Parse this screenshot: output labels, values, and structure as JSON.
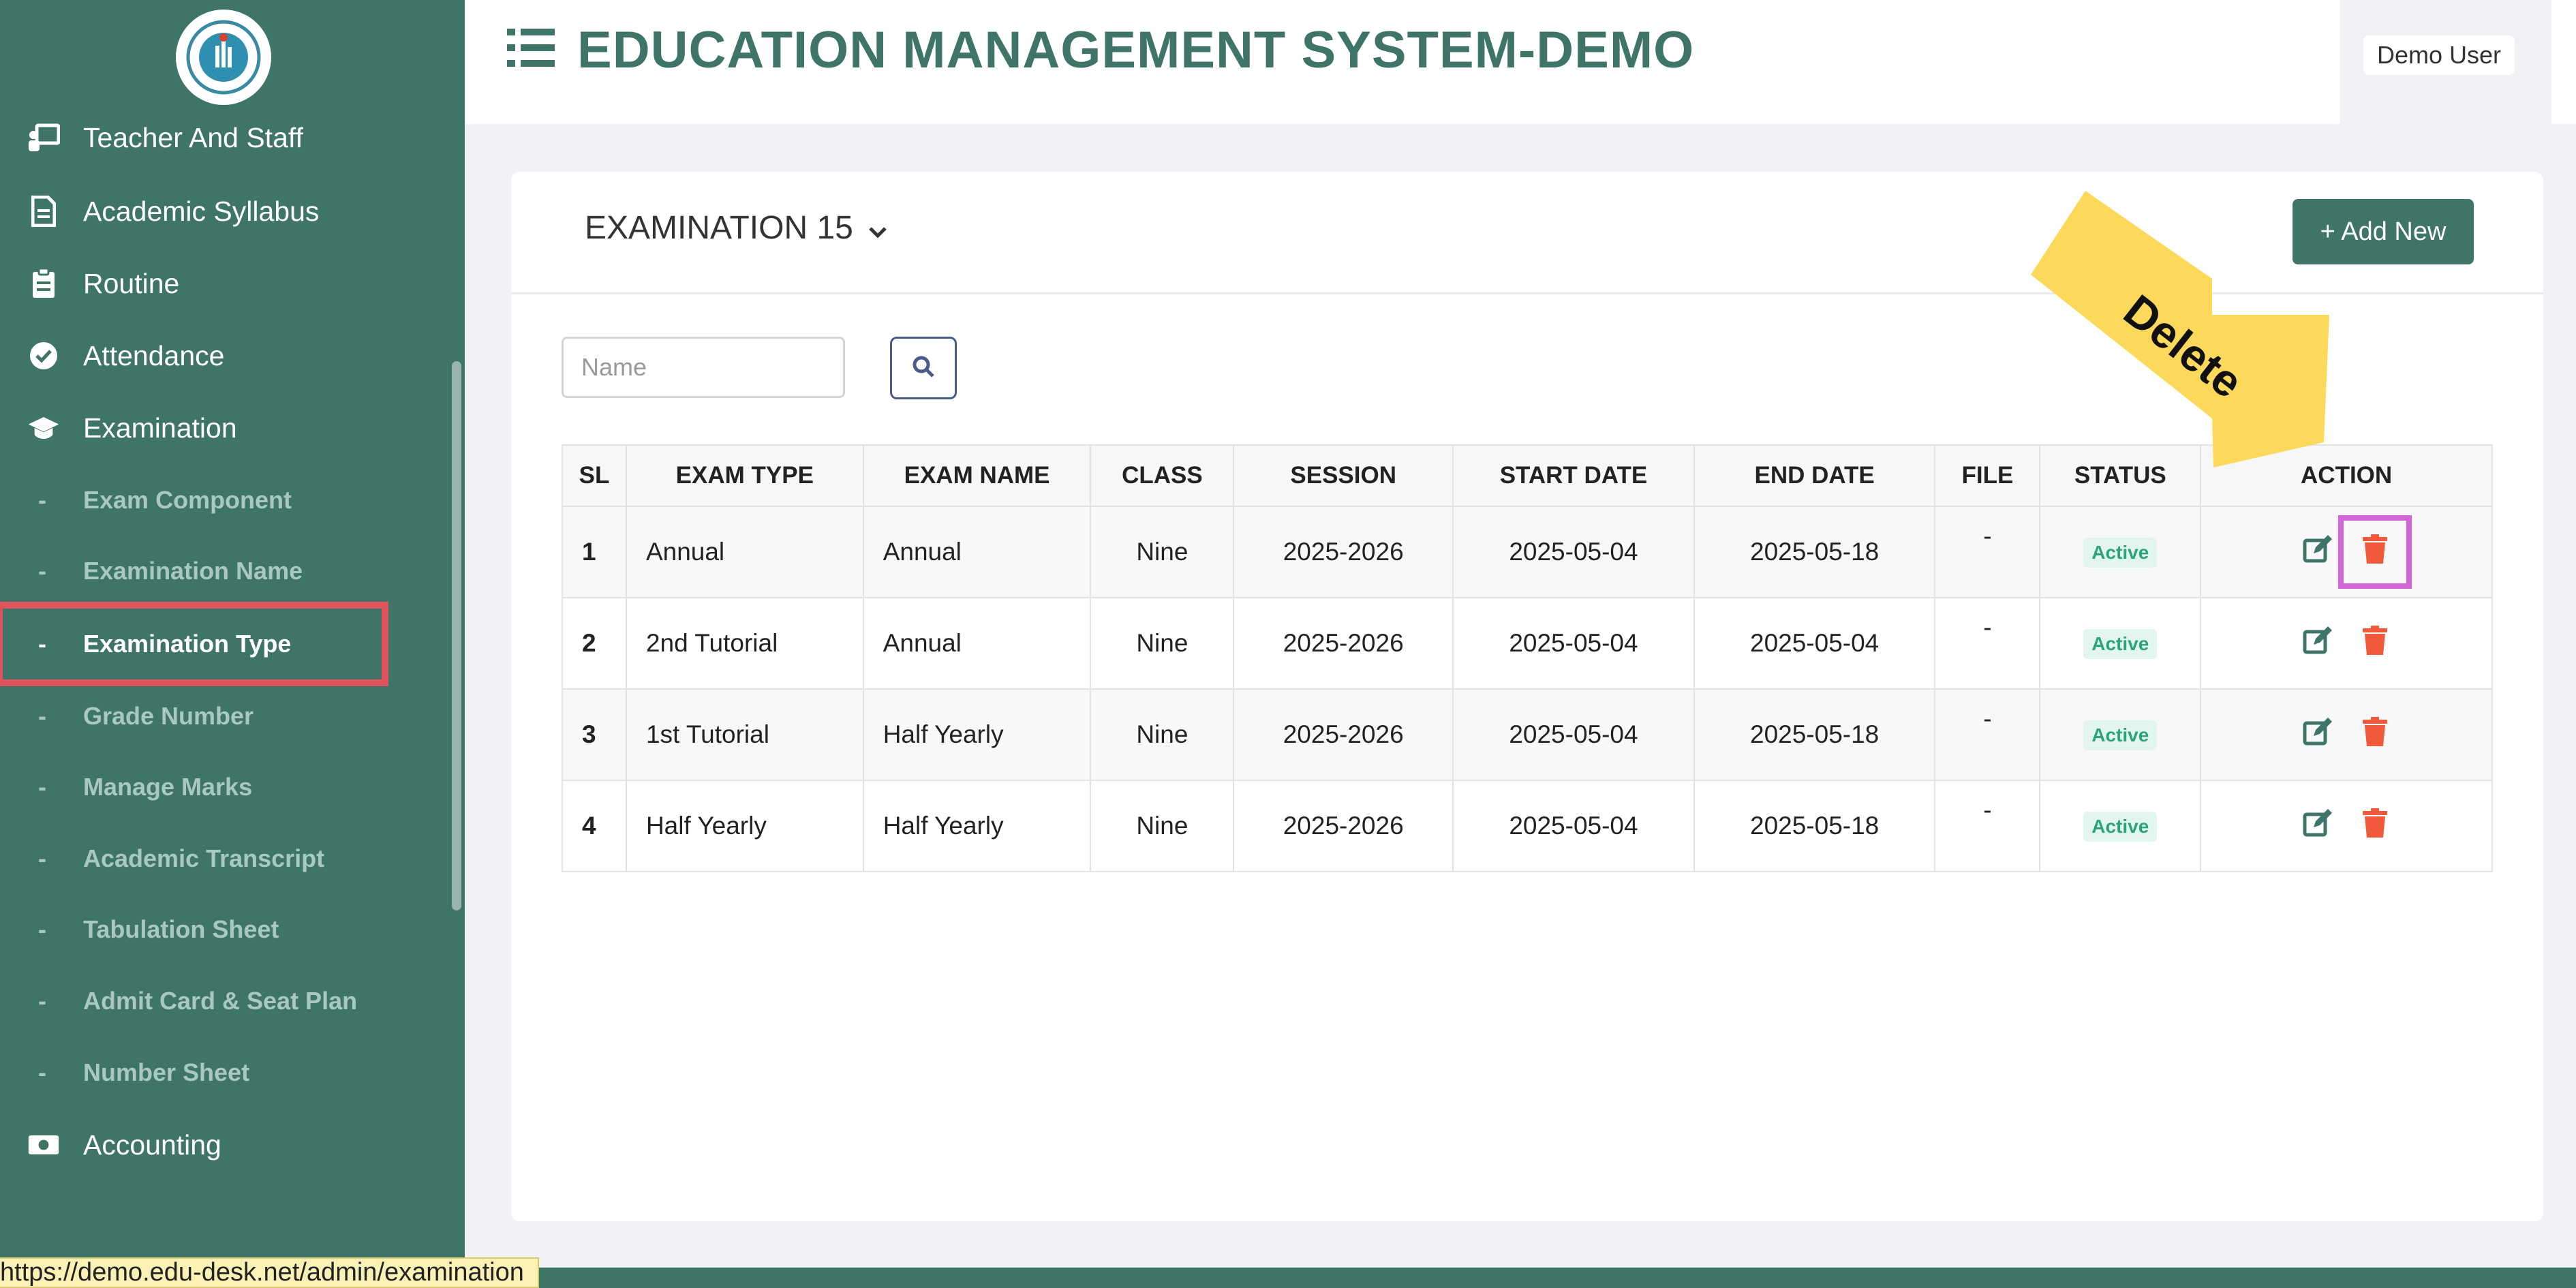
{
  "app_title": "EDUCATION MANAGEMENT SYSTEM-DEMO",
  "user": {
    "name": "Demo User"
  },
  "colors": {
    "primary": "#3f7468",
    "danger": "#f05a3a",
    "highlight": "#e0535c",
    "annotation": "#fcd95a"
  },
  "sidebar": {
    "items": [
      {
        "label": "Teacher And Staff",
        "icon": "teacher-board-icon"
      },
      {
        "label": "Academic Syllabus",
        "icon": "document-icon"
      },
      {
        "label": "Routine",
        "icon": "clipboard-icon"
      },
      {
        "label": "Attendance",
        "icon": "check-circle-icon"
      },
      {
        "label": "Examination",
        "icon": "graduation-cap-icon"
      }
    ],
    "subitems": [
      {
        "label": "Exam Component"
      },
      {
        "label": "Examination Name"
      },
      {
        "label": "Examination Type"
      },
      {
        "label": "Grade Number"
      },
      {
        "label": "Manage Marks"
      },
      {
        "label": "Academic Transcript"
      },
      {
        "label": "Tabulation Sheet"
      },
      {
        "label": "Admit Card & Seat Plan"
      },
      {
        "label": "Number Sheet"
      }
    ],
    "active_subitem": "Examination Type",
    "last_item": {
      "label": "Accounting",
      "icon": "money-icon"
    }
  },
  "card": {
    "selector_label": "EXAMINATION 15",
    "add_button": "+ Add New",
    "search": {
      "placeholder": "Name"
    }
  },
  "table": {
    "columns": [
      "SL",
      "EXAM TYPE",
      "EXAM NAME",
      "CLASS",
      "SESSION",
      "START DATE",
      "END DATE",
      "FILE",
      "STATUS",
      "ACTION"
    ],
    "rows": [
      {
        "sl": "1",
        "exam_type": "Annual",
        "exam_name": "Annual",
        "class": "Nine",
        "session": "2025-2026",
        "start_date": "2025-05-04",
        "end_date": "2025-05-18",
        "file": "-",
        "status": "Active"
      },
      {
        "sl": "2",
        "exam_type": "2nd Tutorial",
        "exam_name": "Annual",
        "class": "Nine",
        "session": "2025-2026",
        "start_date": "2025-05-04",
        "end_date": "2025-05-04",
        "file": "-",
        "status": "Active"
      },
      {
        "sl": "3",
        "exam_type": "1st Tutorial",
        "exam_name": "Half Yearly",
        "class": "Nine",
        "session": "2025-2026",
        "start_date": "2025-05-04",
        "end_date": "2025-05-18",
        "file": "-",
        "status": "Active"
      },
      {
        "sl": "4",
        "exam_type": "Half Yearly",
        "exam_name": "Half Yearly",
        "class": "Nine",
        "session": "2025-2026",
        "start_date": "2025-05-04",
        "end_date": "2025-05-18",
        "file": "-",
        "status": "Active"
      }
    ]
  },
  "annotation": {
    "label": "Delete"
  },
  "status_url": "https://demo.edu-desk.net/admin/examination"
}
